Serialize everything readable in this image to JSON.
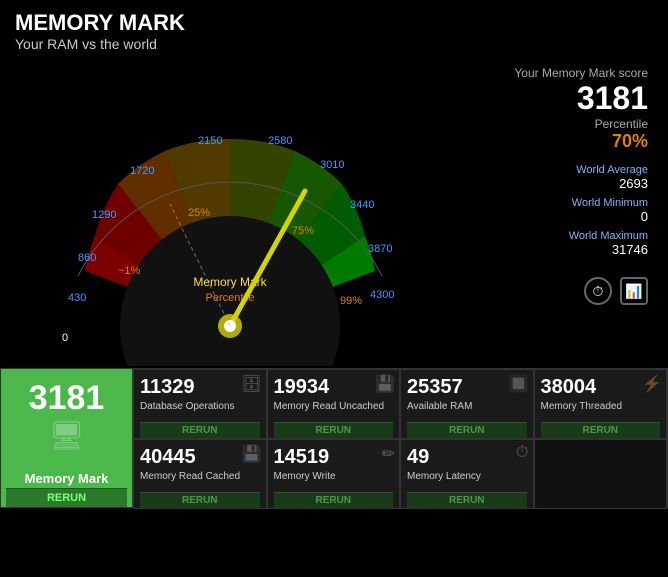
{
  "header": {
    "title": "MEMORY MARK",
    "subtitle": "Your RAM vs the world"
  },
  "right_panel": {
    "your_score_label": "Your Memory Mark score",
    "score": "3181",
    "percentile_label": "Percentile",
    "percentile": "70%",
    "world_average_label": "World Average",
    "world_average": "2693",
    "world_minimum_label": "World Minimum",
    "world_minimum": "0",
    "world_maximum_label": "World Maximum",
    "world_maximum": "31746"
  },
  "gauge": {
    "labels": [
      "0",
      "430",
      "860",
      "1290",
      "1720",
      "2150",
      "2580",
      "3010",
      "3440",
      "3870",
      "4300"
    ],
    "pct_labels": [
      "1%",
      "25%",
      "75%",
      "99%"
    ],
    "center_label": "Memory Mark",
    "center_sublabel": "Percentile"
  },
  "main_tile": {
    "score": "3181",
    "label": "Memory Mark",
    "rerun": "RERUN"
  },
  "tiles": [
    {
      "value": "11329",
      "label": "Database Operations",
      "rerun": "RERUN",
      "row": 0,
      "col": 0
    },
    {
      "value": "19934",
      "label": "Memory Read Uncached",
      "rerun": "RERUN",
      "row": 0,
      "col": 1
    },
    {
      "value": "25357",
      "label": "Available RAM",
      "rerun": "RERUN",
      "row": 0,
      "col": 2
    },
    {
      "value": "38004",
      "label": "Memory Threaded",
      "rerun": "RERUN",
      "row": 0,
      "col": 3
    },
    {
      "value": "40445",
      "label": "Memory Read Cached",
      "rerun": "RERUN",
      "row": 1,
      "col": 0
    },
    {
      "value": "14519",
      "label": "Memory Write",
      "rerun": "RERUN",
      "row": 1,
      "col": 1
    },
    {
      "value": "49",
      "label": "Memory Latency",
      "rerun": "RERUN",
      "row": 1,
      "col": 2
    }
  ]
}
